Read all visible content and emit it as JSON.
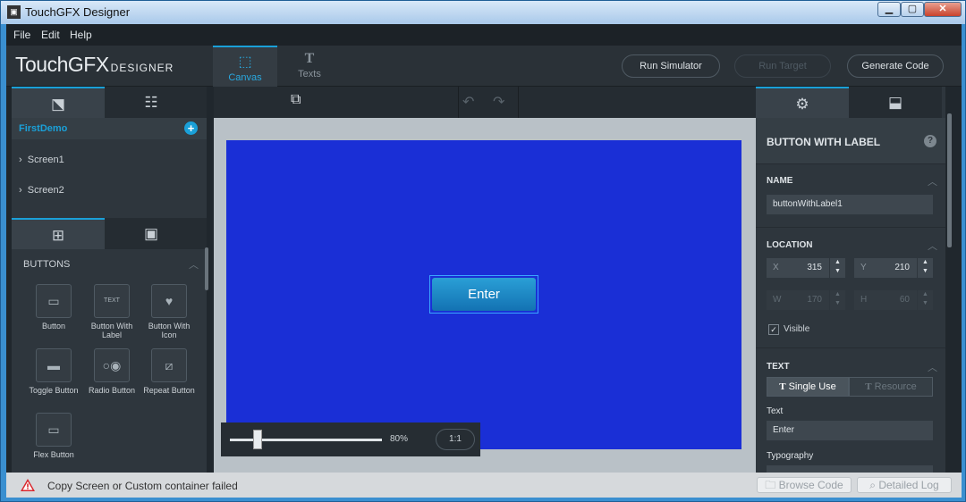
{
  "window": {
    "title": "TouchGFX Designer",
    "app_icon": "TGFX"
  },
  "menu": {
    "items": [
      "File",
      "Edit",
      "Help"
    ]
  },
  "topbar": {
    "logo_main": "TouchGFX",
    "logo_sub": "DESIGNER",
    "tabs": [
      {
        "label": "Canvas",
        "icon": "canvas-icon"
      },
      {
        "label": "Texts",
        "icon": "texts-icon"
      }
    ],
    "run_simulator": "Run Simulator",
    "run_target": "Run Target",
    "generate_code": "Generate Code"
  },
  "left_panel": {
    "project_name": "FirstDemo",
    "screens": [
      "Screen1",
      "Screen2"
    ],
    "section_title": "BUTTONS",
    "widgets": [
      {
        "label": "Button",
        "icon": "button-icon"
      },
      {
        "label": "Button With Label",
        "icon": "button-with-label-icon",
        "icon_text": "TEXT"
      },
      {
        "label": "Button With Icon",
        "icon": "button-with-icon-icon"
      },
      {
        "label": "Toggle Button",
        "icon": "toggle-button-icon"
      },
      {
        "label": "Radio Button",
        "icon": "radio-button-icon"
      },
      {
        "label": "Repeat Button",
        "icon": "repeat-button-icon"
      },
      {
        "label": "Flex Button",
        "icon": "flex-button-icon"
      }
    ]
  },
  "canvas": {
    "background_color": "#1a2fd6",
    "button_text": "Enter",
    "zoom": "80%",
    "zoom_fraction": 0.18,
    "zoom_reset": "1:1"
  },
  "properties": {
    "title": "BUTTON WITH LABEL",
    "name_section": "NAME",
    "name_value": "buttonWithLabel1",
    "location_section": "LOCATION",
    "x_label": "X",
    "x_value": "315",
    "y_label": "Y",
    "y_value": "210",
    "w_label": "W",
    "w_value": "170",
    "h_label": "H",
    "h_value": "60",
    "visible_label": "Visible",
    "visible_checked": true,
    "text_section": "TEXT",
    "single_use": "Single Use",
    "resource": "Resource",
    "text_label": "Text",
    "text_value": "Enter",
    "typography_label": "Typography"
  },
  "status": {
    "message": "Copy Screen or Custom container failed",
    "browse_code": "Browse Code",
    "detailed_log": "Detailed Log"
  },
  "colors": {
    "accent": "#1aa0d8",
    "canvas": "#1a2fd6",
    "button": "#1a8ac8"
  }
}
